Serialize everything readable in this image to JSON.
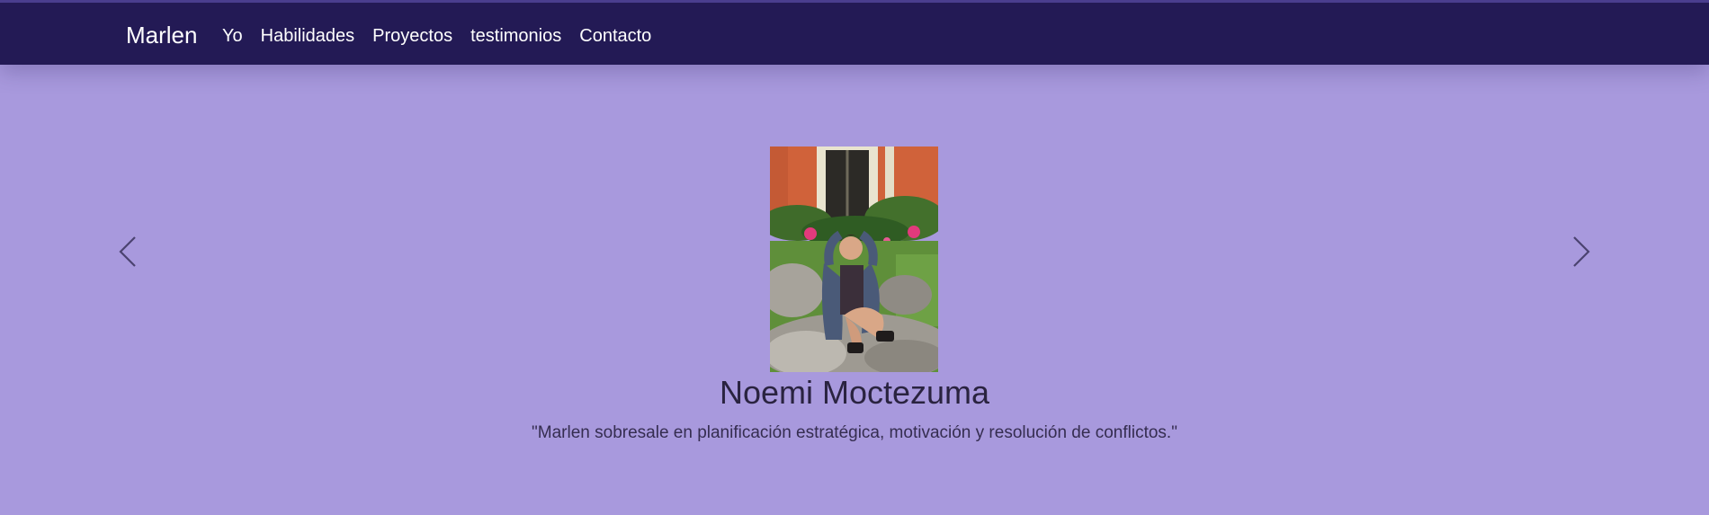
{
  "navbar": {
    "brand": "Marlen",
    "links": [
      {
        "label": "Yo"
      },
      {
        "label": "Habilidades"
      },
      {
        "label": "Proyectos"
      },
      {
        "label": "testimonios"
      },
      {
        "label": "Contacto"
      }
    ]
  },
  "testimonial": {
    "name": "Noemi Moctezuma",
    "quote": "\"Marlen sobresale en planificación estratégica, motivación y resolución de conflictos.\"",
    "photo_icon": "person-photo"
  },
  "carousel": {
    "prev_icon": "chevron-left-icon",
    "next_icon": "chevron-right-icon"
  },
  "colors": {
    "navbar_bg": "#231a55",
    "page_bg": "#a899dd",
    "heading_text": "#2a2340"
  }
}
